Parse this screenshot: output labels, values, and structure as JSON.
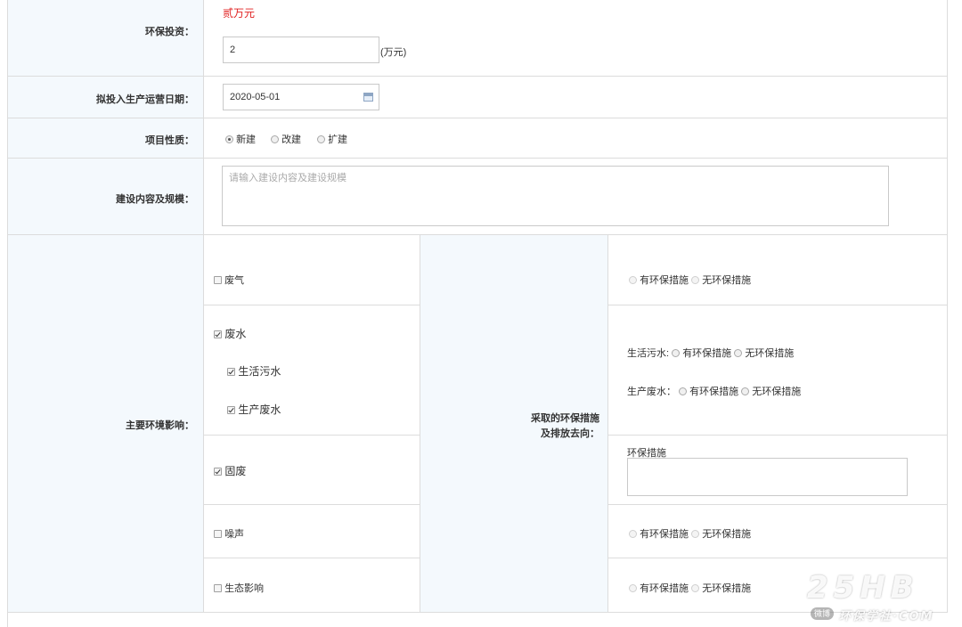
{
  "investment": {
    "label": "环保投资：",
    "amount_text": "贰万元",
    "value": "2",
    "unit": "(万元)"
  },
  "production_date": {
    "label": "拟投入生产运营日期：",
    "value": "2020-05-01",
    "icon": "calendar-icon"
  },
  "project_nature": {
    "label": "项目性质：",
    "options": [
      "新建",
      "改建",
      "扩建"
    ],
    "selected": "新建"
  },
  "construction": {
    "label": "建设内容及规模：",
    "placeholder": "请输入建设内容及建设规模"
  },
  "impacts": {
    "label": "主要环境影响：",
    "measures_label_line1": "采取的环保措施",
    "measures_label_line2": "及排放去向：",
    "waste_gas": {
      "label": "废气",
      "checked": false
    },
    "waste_water": {
      "label": "废水",
      "checked": true
    },
    "domestic_sewage": {
      "label": "生活污水",
      "checked": true
    },
    "production_wastewater": {
      "label": "生产废水",
      "checked": true
    },
    "solid_waste": {
      "label": "固废",
      "checked": true
    },
    "noise": {
      "label": "噪声",
      "checked": false
    },
    "ecology": {
      "label": "生态影响",
      "checked": false
    }
  },
  "measures": {
    "has": "有环保措施",
    "none": "无环保措施",
    "domestic_sewage_label": "生活污水:",
    "production_wastewater_label": "生产废水：",
    "solid_waste_label": "环保措施"
  },
  "watermark": {
    "logo": "25HB",
    "site": "环保学社·COM",
    "badge": "微博"
  }
}
